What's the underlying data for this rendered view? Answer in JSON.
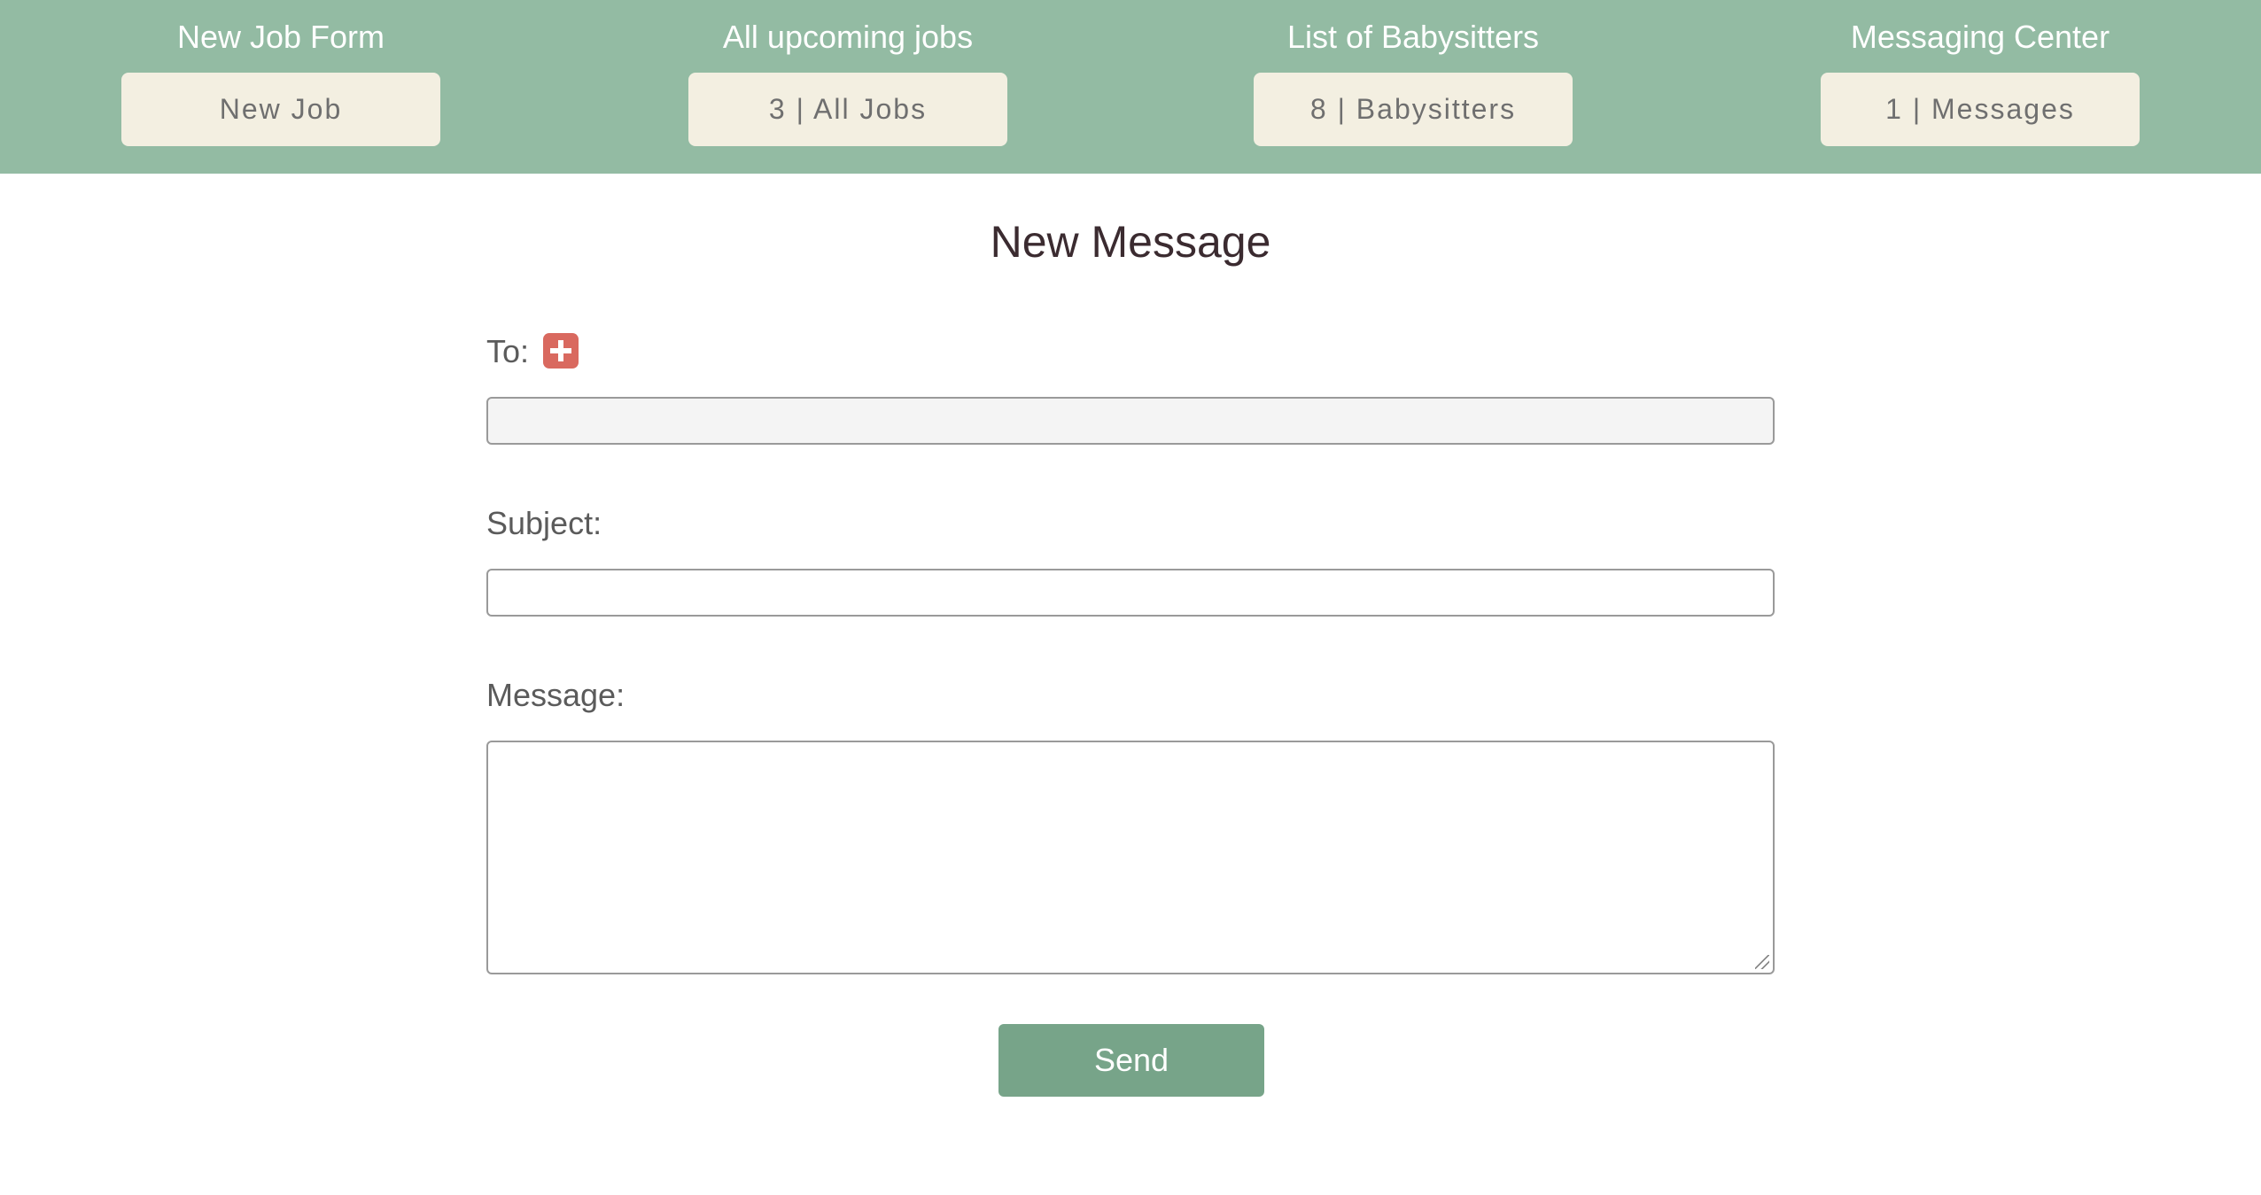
{
  "nav": [
    {
      "title": "New Job Form",
      "button": "New Job"
    },
    {
      "title": "All upcoming jobs",
      "button": "3 | All Jobs"
    },
    {
      "title": "List of Babysitters",
      "button": "8 | Babysitters"
    },
    {
      "title": "Messaging Center",
      "button": "1 | Messages"
    }
  ],
  "page": {
    "title": "New Message"
  },
  "form": {
    "to_label": "To:",
    "to_value": "",
    "subject_label": "Subject:",
    "subject_value": "",
    "message_label": "Message:",
    "message_value": "",
    "send_label": "Send",
    "add_icon": "plus-square-icon"
  },
  "colors": {
    "header": "#93bba3",
    "nav_button": "#f3efe1",
    "send_button": "#77a489",
    "add_icon": "#d9695f"
  }
}
